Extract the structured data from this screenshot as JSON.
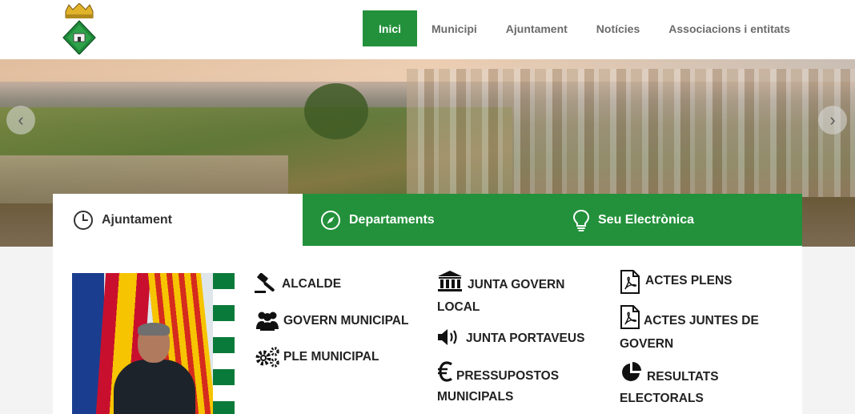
{
  "header": {
    "nav": [
      {
        "label": "Inici",
        "active": true
      },
      {
        "label": "Municipi",
        "active": false
      },
      {
        "label": "Ajuntament",
        "active": false
      },
      {
        "label": "Notícies",
        "active": false
      },
      {
        "label": "Associacions i entitats",
        "active": false
      }
    ]
  },
  "hero": {
    "prev_icon": "chevron-left-icon",
    "next_icon": "chevron-right-icon",
    "prev_glyph": "‹",
    "next_glyph": "›"
  },
  "tabs": [
    {
      "label": "Ajuntament",
      "icon": "clock-icon",
      "active": true
    },
    {
      "label": "Departaments",
      "icon": "compass-icon",
      "active": false
    },
    {
      "label": "Seu Electrònica",
      "icon": "lightbulb-icon",
      "active": false
    }
  ],
  "links": [
    {
      "label": "ALCALDE",
      "icon": "gavel-icon"
    },
    {
      "label": "GOVERN MUNICIPAL",
      "icon": "users-icon"
    },
    {
      "label": "PLE MUNICIPAL",
      "icon": "gears-icon"
    },
    {
      "label": "JUNTA GOVERN LOCAL",
      "icon": "institution-icon"
    },
    {
      "label": "JUNTA PORTAVEUS",
      "icon": "volume-icon"
    },
    {
      "label": "PRESSUPOSTOS MUNICIPALS",
      "icon": "euro-icon"
    },
    {
      "label": "ACTES PLENS",
      "icon": "pdf-file-icon"
    },
    {
      "label": "ACTES JUNTES DE GOVERN",
      "icon": "pdf-file-icon"
    },
    {
      "label": "RESULTATS ELECTORALS",
      "icon": "pie-chart-icon"
    }
  ],
  "colors": {
    "accent": "#23913b",
    "nav_text": "#6b6b6b",
    "panel_bg": "#ffffff",
    "page_bg": "#f3f3f3"
  }
}
